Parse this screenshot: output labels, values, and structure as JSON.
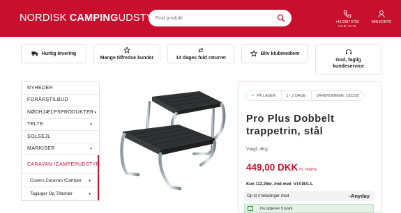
{
  "header": {
    "logo_light": "NORDISK ",
    "logo_bold": "CAMPING",
    "logo_tail": "UDSTYR",
    "search_placeholder": "Find produkt",
    "phone_number": "+45 2087 6750",
    "phone_hours": "Fra kl. 10-18",
    "account_label": "MIN KONTO"
  },
  "usps": [
    {
      "label": "Hurtig levering",
      "icon": "truck-icon"
    },
    {
      "label": "Mange tilfredse kunder",
      "icon": "star-icon"
    },
    {
      "label": "14 dages fuld returret",
      "icon": "refresh-icon"
    },
    {
      "label": "Bliv klubmedlem",
      "icon": "star-icon"
    },
    {
      "label": "God, faglig kundeservice",
      "icon": "headset-icon"
    }
  ],
  "sidebar": {
    "items": [
      {
        "label": "NYHEDER",
        "has_caret": false
      },
      {
        "label": "FORÅRSTILBUD",
        "has_caret": false
      },
      {
        "label": "NØDHJÆLPSPRODUKTER",
        "has_caret": true
      },
      {
        "label": "TELTE",
        "has_caret": true
      },
      {
        "label": "SOLSEJL",
        "has_caret": false
      },
      {
        "label": "MARKISER",
        "has_caret": true
      },
      {
        "label": "CARAVAN-/CAMPERUDSTYR",
        "has_caret": false
      }
    ],
    "subitems": [
      {
        "label": "Covers Caravan /Camper",
        "has_caret": true
      },
      {
        "label": "Tagluger Og Tilbehør",
        "has_caret": true
      }
    ]
  },
  "product": {
    "image_icon": "step-stool-image",
    "stock_status": "PÅ LAGER",
    "delivery": "1 - 2 DAGE",
    "sku": "VARENUMMER: 102238",
    "title_line1": "Pro Plus Dobbelt",
    "title_line2": "trappetrin, stål",
    "weight": "Vægt: 4Kg.",
    "price": "449,00 DKK",
    "vat_note": "m. moms",
    "financing_text": "Kun 112,25kr. /md med",
    "financing_brand": "VIABILL",
    "installments_text": "Op til 4 betalinger med",
    "installments_brand": "-Anyday",
    "points_text": "Du optjener 9 point"
  },
  "colors": {
    "brand_red": "#c8102e",
    "success_green": "#2a8a3e"
  }
}
